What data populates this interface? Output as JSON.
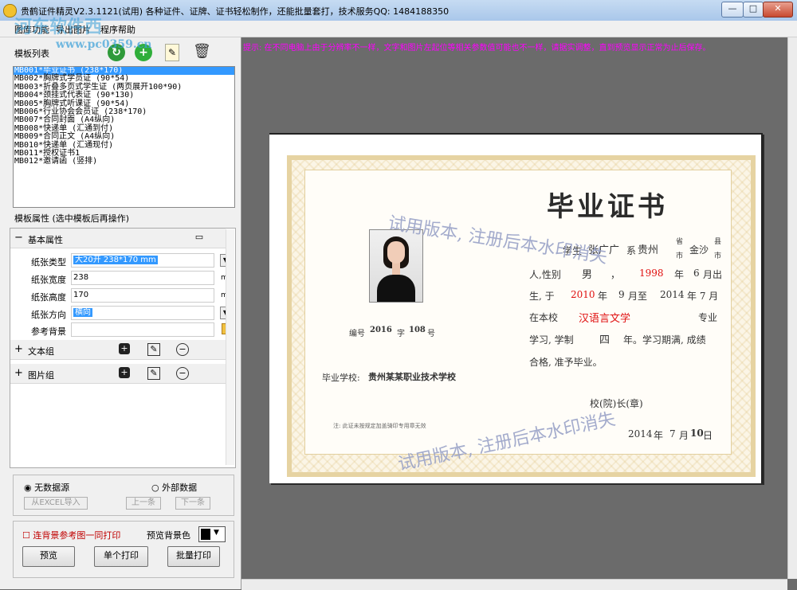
{
  "window": {
    "title": "贵鹤证件精灵V2.3.1121(试用)    各种证件、证牌、证书轻松制作，还能批量套打，技术服务QQ: 1484188350",
    "minimize": "—",
    "maximize": "□",
    "close": "✕"
  },
  "menu": {
    "items": [
      "图库功能",
      "导出图片",
      "程序帮助"
    ]
  },
  "watermark": {
    "logo": "河东软件西",
    "url": "www.pc0359.cn"
  },
  "left": {
    "list_title": "模板列表",
    "templates": [
      "MB001*毕业证书 (238*170)",
      "MB002*胸牌式学员证 (90*54)",
      "MB003*折叠多页式学生证 (两页展开100*90)",
      "MB004*颈挂式代表证 (90*130)",
      "MB005*胸牌式听课证 (90*54)",
      "MB006*行业协会会员证 (238*170)",
      "MB007*合同封面 (A4纵向)",
      "MB008*快递单 (汇通到付)",
      "MB009*合同正文 (A4纵向)",
      "MB010*快递单 (汇通现付)",
      "MB011*授权证书1",
      "MB012*邀请函 (竖排)"
    ],
    "props_title": "模板属性 (选中模板后再操作)",
    "basic_group": "基本属性",
    "fields": {
      "paper_type_label": "纸张类型",
      "paper_type_value": "大20开 238*170 mm",
      "paper_width_label": "纸张宽度",
      "paper_width_value": "238",
      "paper_width_unit": "mm",
      "paper_height_label": "纸张高度",
      "paper_height_value": "170",
      "paper_height_unit": "mm",
      "orientation_label": "纸张方向",
      "orientation_value": "横向",
      "background_label": "参考背景",
      "background_value": ""
    },
    "text_group": "文本组",
    "image_group": "图片组",
    "datasource": {
      "no_source": "无数据源",
      "external": "外部数据",
      "import_excel": "从EXCEL导入",
      "prev": "上一条",
      "next": "下一条"
    },
    "print_bg_label": "连背景参考图一同打印",
    "preview_bg_label": "预览背景色",
    "buttons": {
      "preview": "预览",
      "print_single": "单个打印",
      "print_batch": "批量打印"
    }
  },
  "canvas": {
    "hint": "提示: 在不同电脑上由于分辨率不一样，文字和图片左起位等相关参数值可能也不一样，请据实调整，直到预览显示正常为止后保存。",
    "certificate": {
      "title": "毕业证书",
      "line1": {
        "student_label": "学生",
        "name": "张广广",
        "ji": "系",
        "province": "贵州",
        "sheng": "省",
        "city": "金沙",
        "shi": "市",
        "xian": "县"
      },
      "line2": {
        "gender_label": "人,性别",
        "gender": "男",
        "comma": "，",
        "year": "1998",
        "nian": "年",
        "month": "6",
        "born": "月出"
      },
      "line3": {
        "sheng2": "生, 于",
        "start_year": "2010",
        "nian": "年",
        "start_month": "9",
        "yue": "月至",
        "end_year": "2014",
        "end_month_suffix": "年 7 月"
      },
      "line4": {
        "at_school": "在本校",
        "major": "汉语言文学",
        "major_suffix": "专业"
      },
      "line5": "学习, 学制",
      "duration": "四",
      "line5b": "年。学习期满, 成绩",
      "line6": "合格, 准予毕业。",
      "number_label": "编号",
      "number_year": "2016",
      "zi": "字",
      "number": "108",
      "hao": "号",
      "school_label": "毕业学校:",
      "school": "贵州某某职业技术学校",
      "note": "注: 此证未按规定加盖骑印专用章无效",
      "principal": "校(院)长(章)",
      "date_year": "2014",
      "date_nian": "年",
      "date_month": "7",
      "date_yue": "月",
      "date_day": "10",
      "date_ri": "日",
      "trial_watermark": "试用版本, 注册后本水印消失"
    }
  }
}
